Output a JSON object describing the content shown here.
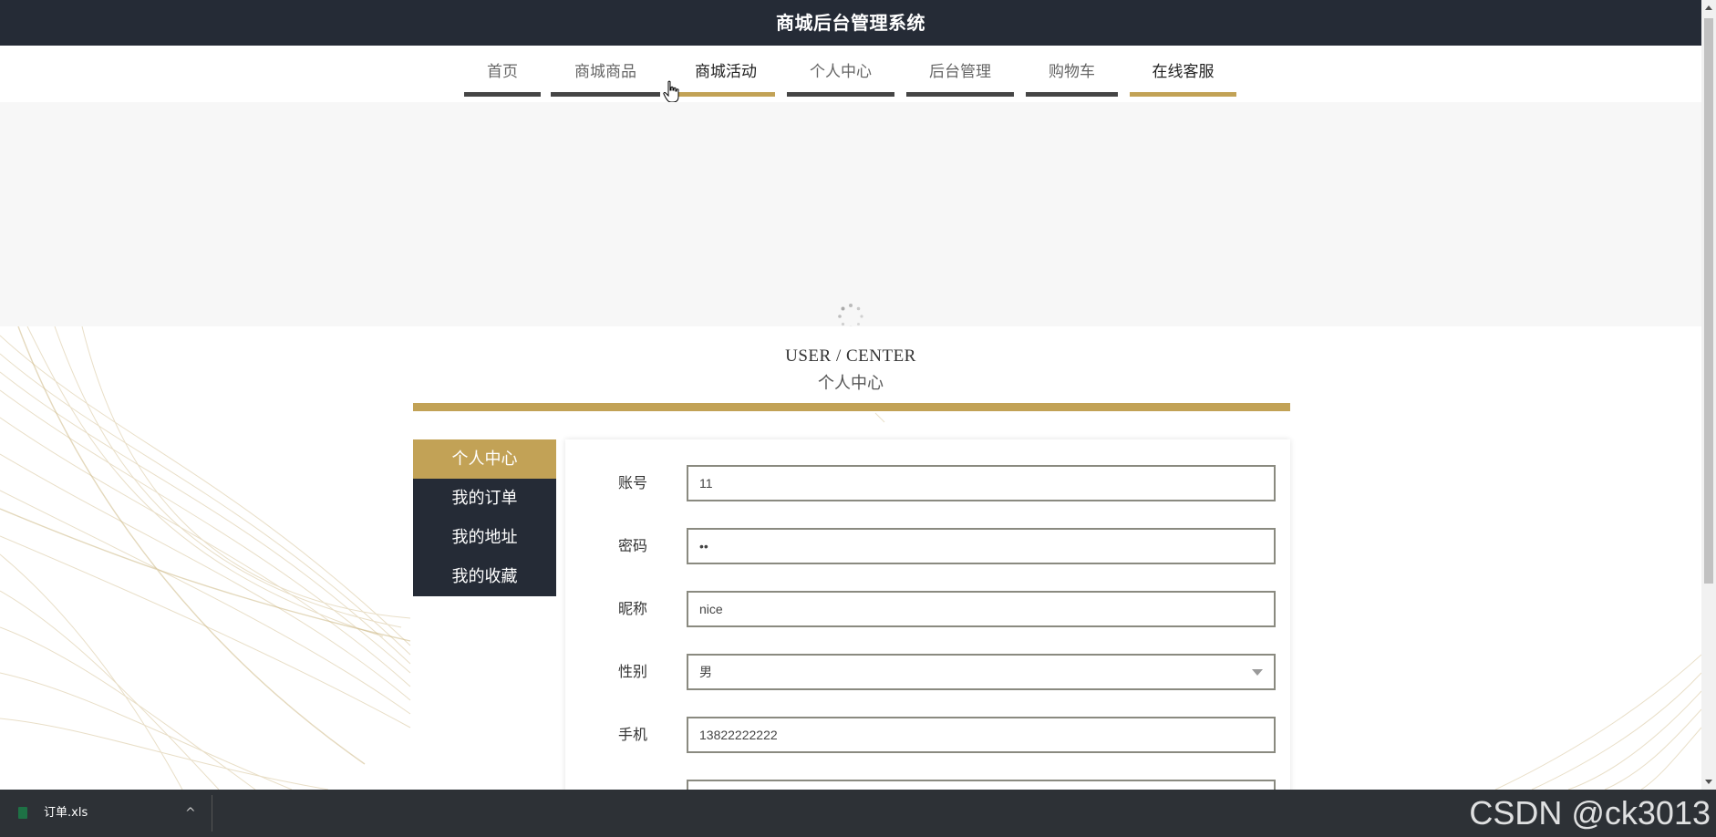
{
  "header": {
    "title": "商城后台管理系统"
  },
  "nav": {
    "items": [
      {
        "label": "首页",
        "active": false
      },
      {
        "label": "商城商品",
        "active": false
      },
      {
        "label": "商城活动",
        "active": true
      },
      {
        "label": "个人中心",
        "active": false
      },
      {
        "label": "后台管理",
        "active": false
      },
      {
        "label": "购物车",
        "active": false
      },
      {
        "label": "在线客服",
        "active": true
      }
    ]
  },
  "section": {
    "title_en": "USER / CENTER",
    "title_cn": "个人中心"
  },
  "sidebar": {
    "items": [
      {
        "label": "个人中心",
        "active": true
      },
      {
        "label": "我的订单",
        "active": false
      },
      {
        "label": "我的地址",
        "active": false
      },
      {
        "label": "我的收藏",
        "active": false
      }
    ]
  },
  "form": {
    "fields": [
      {
        "label": "账号",
        "value": "11",
        "type": "text"
      },
      {
        "label": "密码",
        "value": "••",
        "type": "password"
      },
      {
        "label": "昵称",
        "value": "nice",
        "type": "text"
      },
      {
        "label": "性别",
        "value": "男",
        "type": "select"
      },
      {
        "label": "手机",
        "value": "13822222222",
        "type": "text"
      },
      {
        "label": "",
        "value": "",
        "type": "text"
      }
    ]
  },
  "downloads": {
    "file_name": "订单.xls",
    "chevron": "^"
  },
  "watermark": {
    "text": "CSDN @ck3013"
  },
  "colors": {
    "dark": "#252b36",
    "gold": "#c2a256",
    "banner_bg": "#f7f7f7"
  }
}
